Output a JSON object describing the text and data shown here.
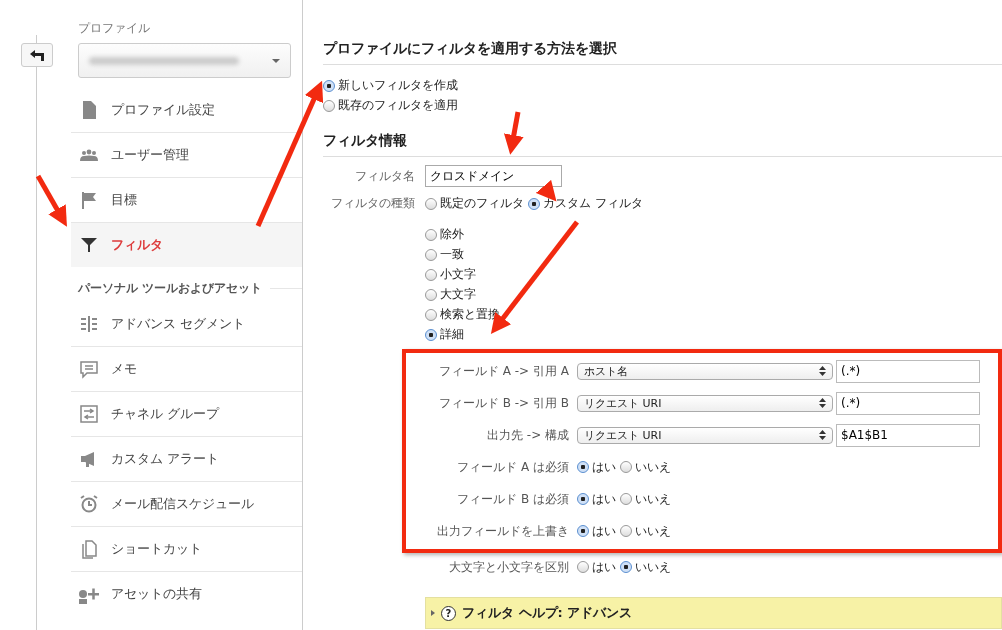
{
  "sidebar": {
    "profile_label": "プロファイル",
    "profile_items": [
      {
        "label": "プロファイル設定",
        "selected": false
      },
      {
        "label": "ユーザー管理",
        "selected": false
      },
      {
        "label": "目標",
        "selected": false
      },
      {
        "label": "フィルタ",
        "selected": true
      }
    ],
    "assets_heading": "パーソナル ツールおよびアセット",
    "asset_items": [
      {
        "label": "アドバンス セグメント"
      },
      {
        "label": "メモ"
      },
      {
        "label": "チャネル グループ"
      },
      {
        "label": "カスタム アラート"
      },
      {
        "label": "メール配信スケジュール"
      },
      {
        "label": "ショートカット"
      },
      {
        "label": "アセットの共有"
      }
    ]
  },
  "main": {
    "heading": "プロファイルにフィルタを適用する方法を選択",
    "apply_methods": [
      {
        "label": "新しいフィルタを作成",
        "selected": true
      },
      {
        "label": "既存のフィルタを適用",
        "selected": false
      }
    ],
    "info_heading": "フィルタ情報",
    "name_label": "フィルタ名",
    "name_value": "クロスドメイン",
    "type_label": "フィルタの種類",
    "type_options": [
      {
        "label": "既定のフィルタ",
        "selected": false
      },
      {
        "label": "カスタム フィルタ",
        "selected": true
      }
    ],
    "custom_types": [
      {
        "label": "除外",
        "selected": false
      },
      {
        "label": "一致",
        "selected": false
      },
      {
        "label": "小文字",
        "selected": false
      },
      {
        "label": "大文字",
        "selected": false
      },
      {
        "label": "検索と置換",
        "selected": false
      },
      {
        "label": "詳細",
        "selected": true
      }
    ],
    "advanced_fields": [
      {
        "label": "フィールド A -> 引用 A",
        "select": "ホスト名",
        "value": "(.*)"
      },
      {
        "label": "フィールド B -> 引用 B",
        "select": "リクエスト URI",
        "value": "(.*)"
      },
      {
        "label": "出力先 -> 構成",
        "select": "リクエスト URI",
        "value": "$A1$B1"
      }
    ],
    "advanced_choices": [
      {
        "label": "フィールド A は必須",
        "options": [
          {
            "label": "はい",
            "selected": true
          },
          {
            "label": "いいえ",
            "selected": false
          }
        ]
      },
      {
        "label": "フィールド B は必須",
        "options": [
          {
            "label": "はい",
            "selected": true
          },
          {
            "label": "いいえ",
            "selected": false
          }
        ]
      },
      {
        "label": "出力フィールドを上書き",
        "options": [
          {
            "label": "はい",
            "selected": true
          },
          {
            "label": "いいえ",
            "selected": false
          }
        ]
      }
    ],
    "case_choice": {
      "label": "大文字と小文字を区別",
      "options": [
        {
          "label": "はい",
          "selected": false
        },
        {
          "label": "いいえ",
          "selected": true
        }
      ]
    },
    "help": {
      "icon": "?",
      "title": "フィルタ ヘルプ: アドバンス",
      "expanded": false
    }
  }
}
